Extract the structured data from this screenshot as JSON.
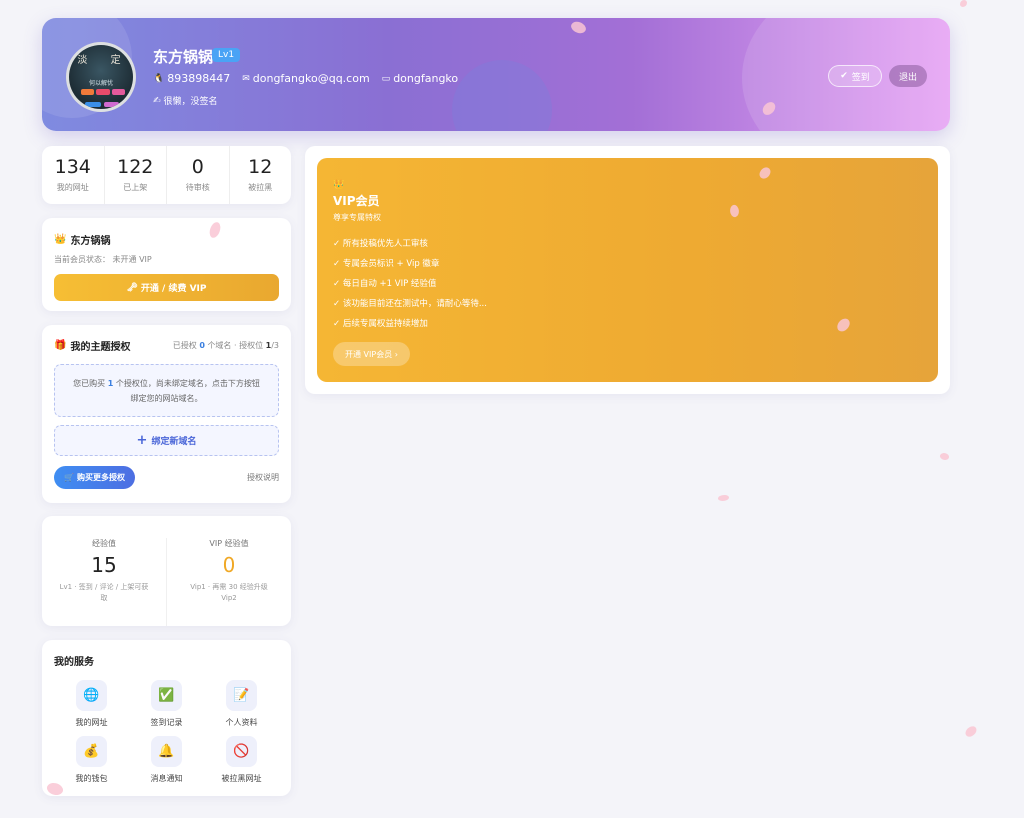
{
  "header": {
    "username": "东方锅锅",
    "level": "Lv1",
    "qq": "893898447",
    "email": "dongfangko@qq.com",
    "site": "dongfangko",
    "signature": "很懒，没签名",
    "sign_in_label": "签到",
    "logout_label": "退出",
    "avatar_text_top": "淡 定",
    "avatar_text_mid": "何以解忧"
  },
  "stats": [
    {
      "num": "134",
      "label": "我的网址"
    },
    {
      "num": "122",
      "label": "已上架"
    },
    {
      "num": "0",
      "label": "待审核"
    },
    {
      "num": "12",
      "label": "被拉黑"
    }
  ],
  "member": {
    "name": "东方锅锅",
    "status": "当前会员状态：  未开通 VIP",
    "button": "开通 / 续费 VIP"
  },
  "theme_auth": {
    "title": "我的主题授权",
    "stat_prefix": "已授权",
    "stat_count": "0",
    "stat_mid": "个域名 · 授权位",
    "stat_ratio": "1",
    "stat_total": "/3",
    "notice_pre": "您已购买",
    "notice_num": "1",
    "notice_post": "个授权位，尚未绑定域名，点击下方按钮",
    "notice_line2": "绑定您的网站域名。",
    "bind_label": "绑定新域名",
    "buy_label": "购买更多授权",
    "doc_label": "授权说明"
  },
  "experience": {
    "exp_label": "经验值",
    "exp_value": "15",
    "exp_desc": "Lv1 · 签到 / 评论 / 上架可获取",
    "vip_label": "VIP 经验值",
    "vip_value": "0",
    "vip_desc": "Vip1 · 再需 30 经验升级 Vip2"
  },
  "services": {
    "title": "我的服务",
    "items": [
      {
        "label": "我的网址",
        "icon": "globe-icon",
        "glyph": "🌐"
      },
      {
        "label": "签到记录",
        "icon": "checkmark-icon",
        "glyph": "✅"
      },
      {
        "label": "个人资料",
        "icon": "profile-edit-icon",
        "glyph": "📝"
      },
      {
        "label": "我的钱包",
        "icon": "money-bag-icon",
        "glyph": "💰"
      },
      {
        "label": "消息通知",
        "icon": "bell-icon",
        "glyph": "🔔"
      },
      {
        "label": "被拉黑网址",
        "icon": "prohibited-icon",
        "glyph": "🚫"
      }
    ]
  },
  "vip_panel": {
    "title": "VIP会员",
    "subtitle": "尊享专属特权",
    "benefits": [
      "✓ 所有投稿优先人工审核",
      "✓ 专属会员标识 + Vip 徽章",
      "✓ 每日自动 +1 VIP 经验值",
      "✓ 该功能目前还在测试中，请耐心等待...",
      "✓ 后续专属权益持续增加"
    ],
    "open_label": "开通 VIP会员 ›"
  },
  "colors": {
    "accent_blue": "#3a7fe0",
    "vip_gold": "#f5b634",
    "header_start": "#7f8be0",
    "header_end": "#e6a2f4"
  }
}
